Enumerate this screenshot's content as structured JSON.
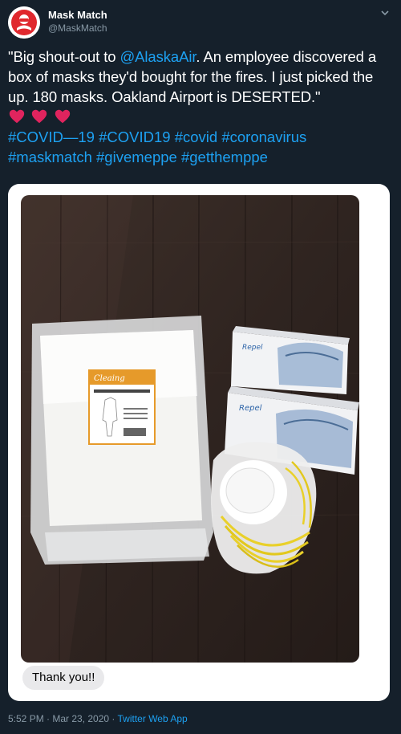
{
  "account": {
    "display_name": "Mask Match",
    "handle": "@MaskMatch",
    "avatar_icon": "mask-match-logo",
    "brand_color": "#e0282e"
  },
  "tweet": {
    "text_before_mention": "\"Big shout-out to ",
    "mention": "@AlaskaAir",
    "text_after_mention": ". An employee discovered a box of masks they'd bought for the fires. I just picked the up. 180 masks. Oakland Airport is DESERTED.\"",
    "emoji": [
      "red-heart",
      "red-heart",
      "red-heart"
    ],
    "hashtags": [
      "#COVID—19",
      "#COVID19",
      "#covid",
      "#coronavirus",
      "#maskmatch",
      "#givemeppe",
      "#getthemppe"
    ]
  },
  "media": {
    "coverall_brand": "Cleaing",
    "mask_box_brand": "Repel",
    "message_bubble": "Thank you!!"
  },
  "footer": {
    "time_date": "5:52 PM · Mar 23, 2020 · ",
    "source": "Twitter Web App"
  },
  "icons": {
    "menu": "chevron-down-icon",
    "heart": "red-heart-emoji"
  },
  "colors": {
    "background": "#15202b",
    "link": "#1da1f2",
    "secondary_text": "#8899a6",
    "heart": "#e0245e"
  }
}
